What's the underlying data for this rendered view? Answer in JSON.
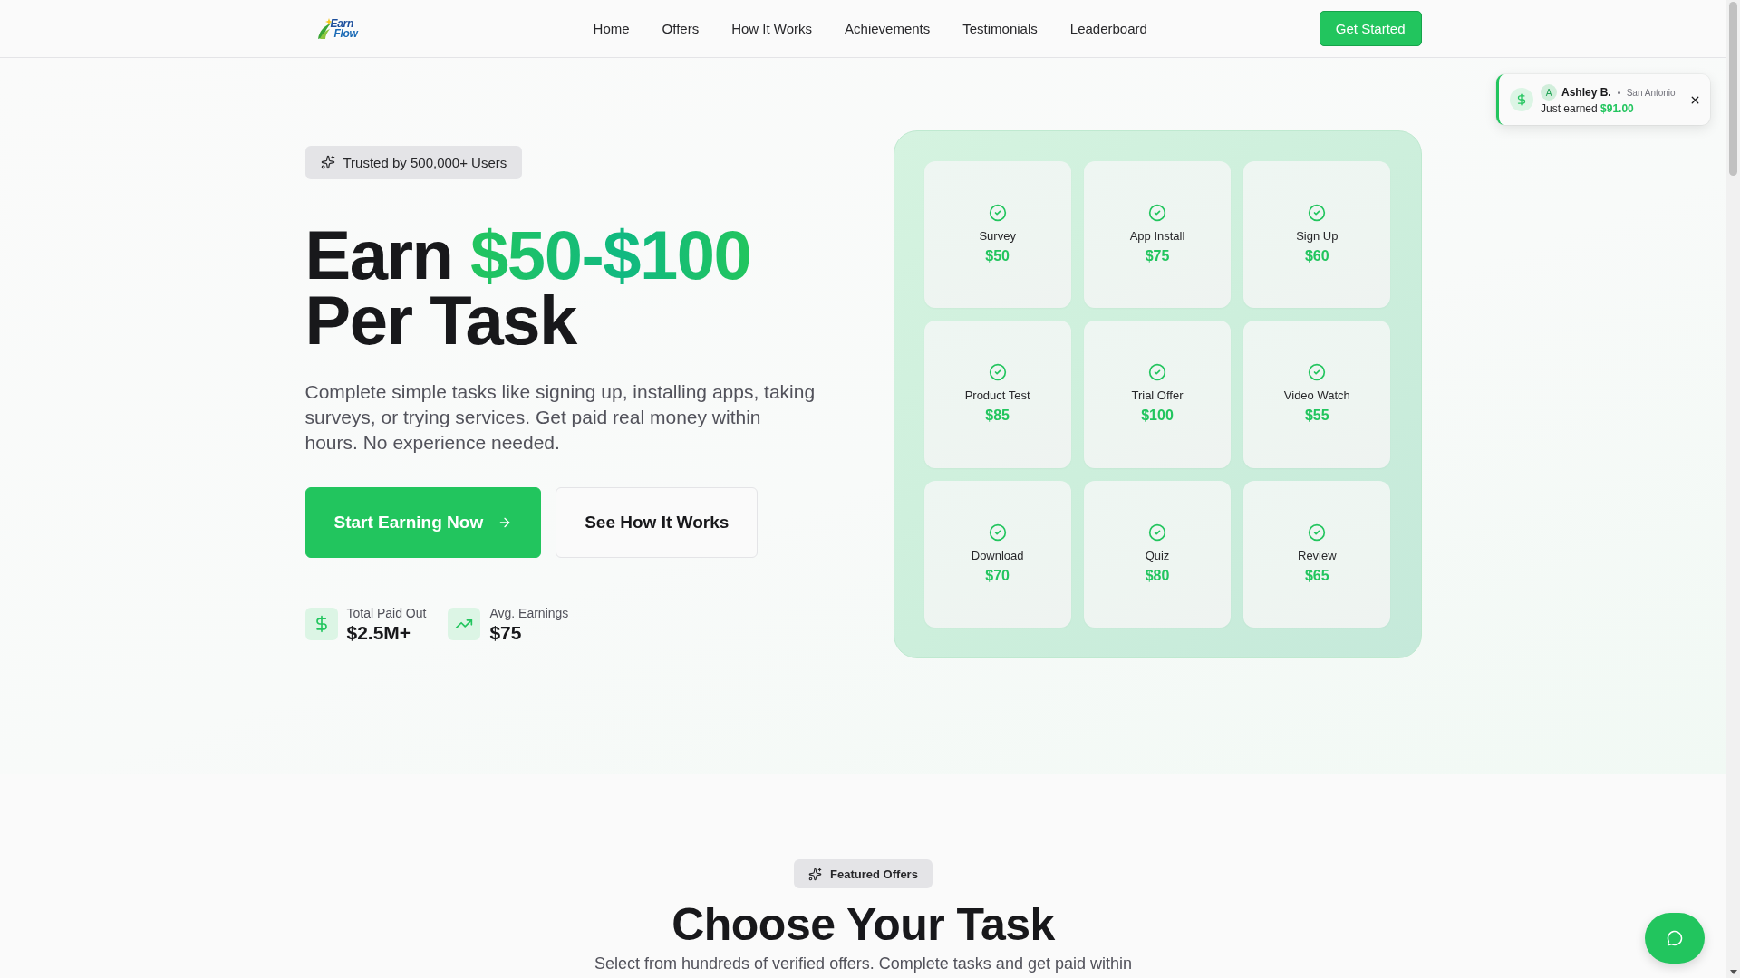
{
  "header": {
    "logo": {
      "lines": [
        "Earn",
        "Flow"
      ]
    },
    "nav": [
      "Home",
      "Offers",
      "How It Works",
      "Achievements",
      "Testimonials",
      "Leaderboard"
    ],
    "cta": "Get Started"
  },
  "hero": {
    "badge": "Trusted by 500,000+ Users",
    "title": {
      "lead": "Earn",
      "highlight": "$50-$100",
      "tail": "Per Task"
    },
    "description": "Complete simple tasks like signing up, installing apps, taking surveys, or trying services. Get paid real money within hours. No experience needed.",
    "buttons": [
      {
        "label": "Start Earning Now",
        "kind": "primary"
      },
      {
        "label": "See How It Works",
        "kind": "secondary"
      }
    ],
    "stats": [
      {
        "label": "Total Paid Out",
        "value": "$2.5M+",
        "kind": "dollar"
      },
      {
        "label": "Avg. Earnings",
        "value": "$75",
        "kind": "trend"
      }
    ],
    "tasks": [
      {
        "name": "Survey",
        "reward": "$50"
      },
      {
        "name": "App Install",
        "reward": "$75"
      },
      {
        "name": "Sign Up",
        "reward": "$60"
      },
      {
        "name": "Product Test",
        "reward": "$85"
      },
      {
        "name": "Trial Offer",
        "reward": "$100"
      },
      {
        "name": "Video Watch",
        "reward": "$55"
      },
      {
        "name": "Download",
        "reward": "$70"
      },
      {
        "name": "Quiz",
        "reward": "$80"
      },
      {
        "name": "Review",
        "reward": "$65"
      }
    ]
  },
  "notification": {
    "avatar": "A",
    "name": "Ashley B.",
    "location": "San Antonio",
    "message": "Just earned",
    "amount": "$91.00"
  },
  "offers_section": {
    "badge": "Featured Offers",
    "title": "Choose Your Task",
    "subtitle": "Select from hundreds of verified offers. Complete tasks and get paid within"
  }
}
